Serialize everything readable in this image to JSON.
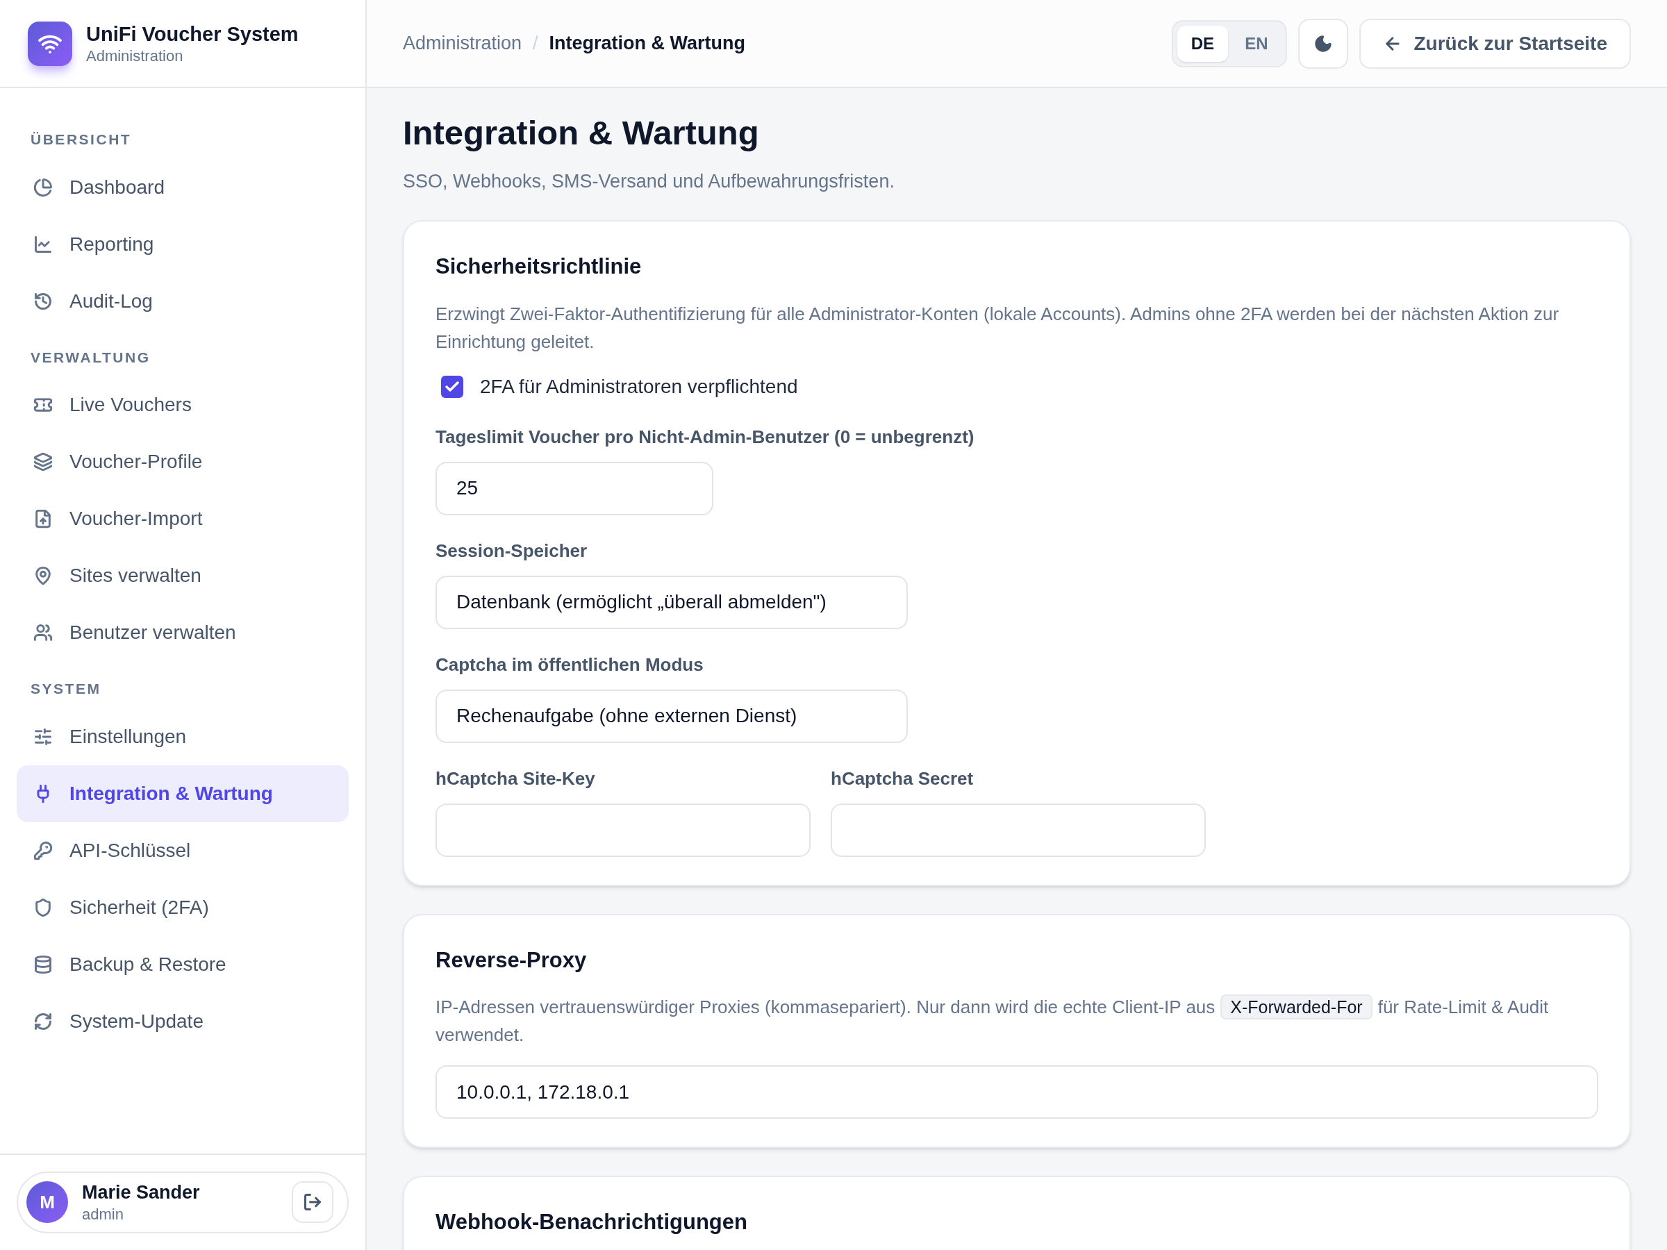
{
  "brand": {
    "title": "UniFi Voucher System",
    "subtitle": "Administration"
  },
  "sidebar": {
    "sections": [
      {
        "label": "ÜBERSICHT",
        "items": [
          {
            "label": "Dashboard",
            "selected": false
          },
          {
            "label": "Reporting",
            "selected": false
          },
          {
            "label": "Audit-Log",
            "selected": false
          }
        ]
      },
      {
        "label": "VERWALTUNG",
        "items": [
          {
            "label": "Live Vouchers",
            "selected": false
          },
          {
            "label": "Voucher-Profile",
            "selected": false
          },
          {
            "label": "Voucher-Import",
            "selected": false
          },
          {
            "label": "Sites verwalten",
            "selected": false
          },
          {
            "label": "Benutzer verwalten",
            "selected": false
          }
        ]
      },
      {
        "label": "SYSTEM",
        "items": [
          {
            "label": "Einstellungen",
            "selected": false
          },
          {
            "label": "Integration & Wartung",
            "selected": true
          },
          {
            "label": "API-Schlüssel",
            "selected": false
          },
          {
            "label": "Sicherheit (2FA)",
            "selected": false
          },
          {
            "label": "Backup & Restore",
            "selected": false
          },
          {
            "label": "System-Update",
            "selected": false
          }
        ]
      }
    ],
    "user": {
      "initial": "M",
      "name": "Marie Sander",
      "role": "admin"
    }
  },
  "header": {
    "breadcrumbs": [
      "Administration",
      "/",
      "Integration & Wartung"
    ],
    "languages": [
      {
        "label": "DE",
        "selected": true
      },
      {
        "label": "EN",
        "selected": false
      }
    ],
    "back_button": "Zurück zur Startseite"
  },
  "page": {
    "title": "Integration & Wartung",
    "subtitle": "SSO, Webhooks, SMS-Versand und Aufbewahrungsfristen."
  },
  "cards": [
    {
      "title": "Sicherheitsrichtlinie",
      "description": [
        "Erzwingt Zwei-Faktor-Authentifizierung für alle Administrator-Konten (lokale Accounts). Admins ohne 2FA werden bei der nächsten Aktion zur Einrichtung geleitet."
      ],
      "fields": [
        {
          "kind": "checkbox",
          "label": "2FA für Administratoren verpflichtend",
          "checked": true
        },
        {
          "kind": "number",
          "label": "Tageslimit Voucher pro Nicht-Admin-Benutzer (0 = unbegrenzt)",
          "value": "25"
        },
        {
          "kind": "select",
          "label": "Session-Speicher",
          "value": "Datenbank (ermöglicht „überall abmelden\")"
        },
        {
          "kind": "select",
          "label": "Captcha im öffentlichen Modus",
          "value": "Rechenaufgabe (ohne externen Dienst)"
        },
        {
          "kind": "pair",
          "items": [
            {
              "label": "hCaptcha Site-Key"
            },
            {
              "label": "hCaptcha Secret"
            }
          ]
        }
      ]
    },
    {
      "title": "Reverse-Proxy",
      "description": [
        "IP-Adressen vertrauenswürdiger Proxies (kommasepariert). Nur dann wird die echte Client-IP aus",
        "X-Forwarded-For",
        "für Rate-Limit & Audit verwendet."
      ],
      "fields": [
        {
          "kind": "text",
          "value": "10.0.0.1, 172.18.0.1"
        }
      ]
    },
    {
      "title": "Webhook-Benachrichtigungen"
    }
  ]
}
